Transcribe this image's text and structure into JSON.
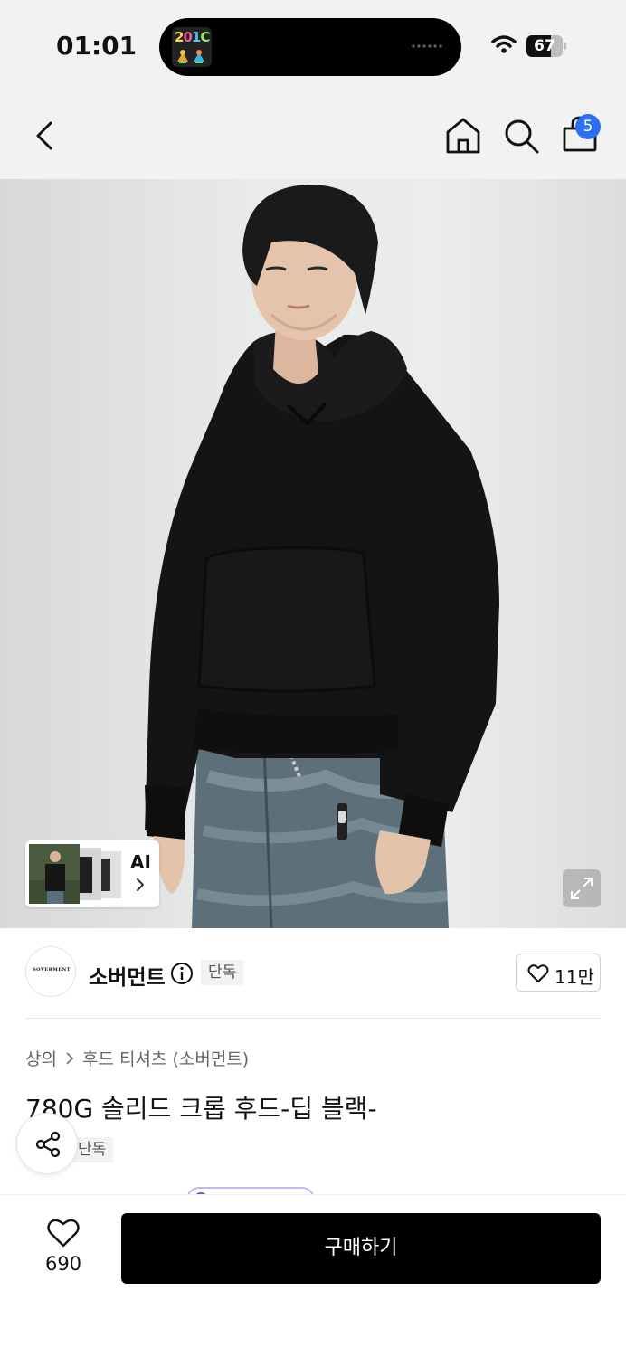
{
  "status_bar": {
    "time": "01:01",
    "battery_level": "67",
    "battery_fraction": 0.67,
    "island_app_text": [
      "2",
      "0",
      "1",
      "C"
    ]
  },
  "nav": {
    "cart_count": "5",
    "icons": [
      "back-icon",
      "home-icon",
      "search-icon",
      "shopping-bag-icon"
    ]
  },
  "product_image": {
    "ai_label": "AI"
  },
  "brand": {
    "logo_text": "SOVERMENT",
    "name": "소버먼트",
    "exclusive_label": "단독",
    "like_count": "11만"
  },
  "breadcrumb": {
    "category": "상의",
    "subcategory": "후드 티셔츠 (소버먼트)"
  },
  "product": {
    "title": "780G 솔리드 크롭 후드-딥 블랙-",
    "exclusive_label": "단독"
  },
  "bottom_bar": {
    "wish_count": "690",
    "buy_label": "구매하기"
  },
  "colors": {
    "accent_blue": "#2e6ff2",
    "buy_button": "#000000",
    "tag_bg": "#f2f2f2"
  }
}
